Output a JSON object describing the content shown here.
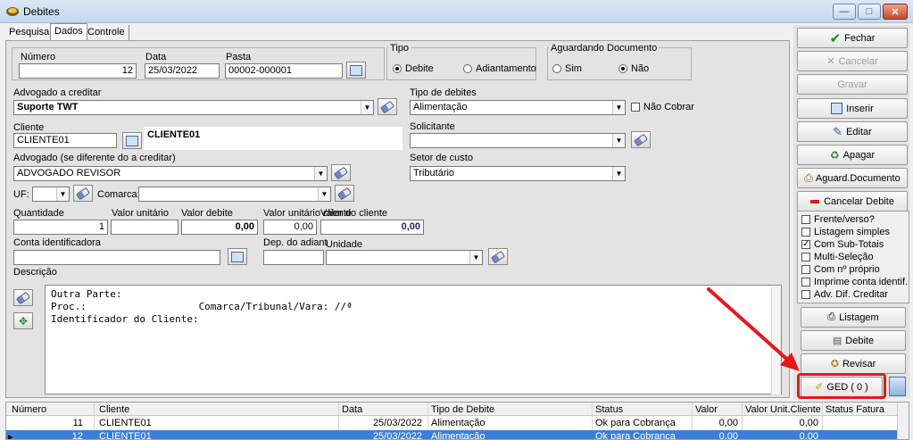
{
  "window": {
    "title": "Debites",
    "minimize": "—",
    "maximize": "□",
    "close": "✕"
  },
  "tabs": [
    "Pesquisa",
    "Dados",
    "Controle"
  ],
  "form": {
    "numero_label": "Número",
    "numero_value": "12",
    "data_label": "Data",
    "data_value": "25/03/2022",
    "pasta_label": "Pasta",
    "pasta_value": "00002-000001",
    "tipo_label": "Tipo",
    "tipo_opt1": "Debite",
    "tipo_opt2": "Adiantamento",
    "aguardando_label": "Aguardando Documento",
    "ag_opt1": "Sim",
    "ag_opt2": "Não",
    "advogado_credit_label": "Advogado a creditar",
    "advogado_credit_value": "Suporte TWT",
    "tipo_debites_label": "Tipo de debites",
    "tipo_debites_value": "Alimentação",
    "nao_cobrar_label": "Não Cobrar",
    "cliente_label": "Cliente",
    "cliente_value": "CLIENTE01",
    "cliente_name": "CLIENTE01",
    "solicitante_label": "Solicitante",
    "solicitante_value": "",
    "advogado_label": "Advogado  (se diferente do a creditar)",
    "advogado_value": "ADVOGADO REVISOR",
    "setor_label": "Setor de custo",
    "setor_value": "Tributário",
    "uf_label": "UF:",
    "comarca_label": "Comarca:",
    "quantidade_label": "Quantidade",
    "quantidade_value": "1",
    "valor_unit_label": "Valor unitário",
    "valor_unit_value": "",
    "valor_debite_label": "Valor debite",
    "valor_debite_value": "0,00",
    "valor_unit_cli_label": "Valor unitário cliente",
    "valor_unit_cli_value": "0,00",
    "valor_cli_label": "Valor do cliente",
    "valor_cli_value": "0,00",
    "conta_label": "Conta identificadora",
    "conta_value": "",
    "dep_label": "Dep. do adiant",
    "unidade_label": "Unidade",
    "descricao_label": "Descrição",
    "descricao_lines": [
      "Outra Parte:",
      "Proc.:                   Comarca/Tribunal/Vara: //ª",
      "Identificador do Cliente:"
    ]
  },
  "actions": {
    "fechar": "Fechar",
    "cancelar": "Cancelar",
    "gravar": "Gravar",
    "inserir": "Inserir",
    "editar": "Editar",
    "apagar": "Apagar",
    "aguard": "Aguard.Documento",
    "cancelar_debite": "Cancelar Debite",
    "listagem": "Listagem",
    "debite": "Debite",
    "revisar": "Revisar",
    "ged": "GED ( 0 )"
  },
  "options": [
    {
      "label": "Frente/verso?",
      "checked": false
    },
    {
      "label": "Listagem simples",
      "checked": false
    },
    {
      "label": "Com Sub-Totais",
      "checked": true
    },
    {
      "label": "Multi-Seleção",
      "checked": false
    },
    {
      "label": "Com nº próprio",
      "checked": false
    },
    {
      "label": "Imprime conta identif.",
      "checked": false
    },
    {
      "label": "Adv. Dif. Creditar",
      "checked": false
    }
  ],
  "grid": {
    "headers": [
      "Número",
      "Cliente",
      "Data",
      "Tipo de Debite",
      "Status",
      "Valor",
      "Valor Unit.Cliente",
      "Status Fatura"
    ],
    "rows": [
      [
        "11",
        "CLIENTE01",
        "25/03/2022",
        "Alimentação",
        "Ok para Cobrança",
        "0,00",
        "0,00",
        ""
      ],
      [
        "12",
        "CLIENTE01",
        "25/03/2022",
        "Alimentação",
        "Ok para Cobrança",
        "0,00",
        "0,00",
        ""
      ]
    ]
  },
  "colors": {
    "highlight": "#e5191a",
    "selected_row": "#3d7fd8"
  }
}
